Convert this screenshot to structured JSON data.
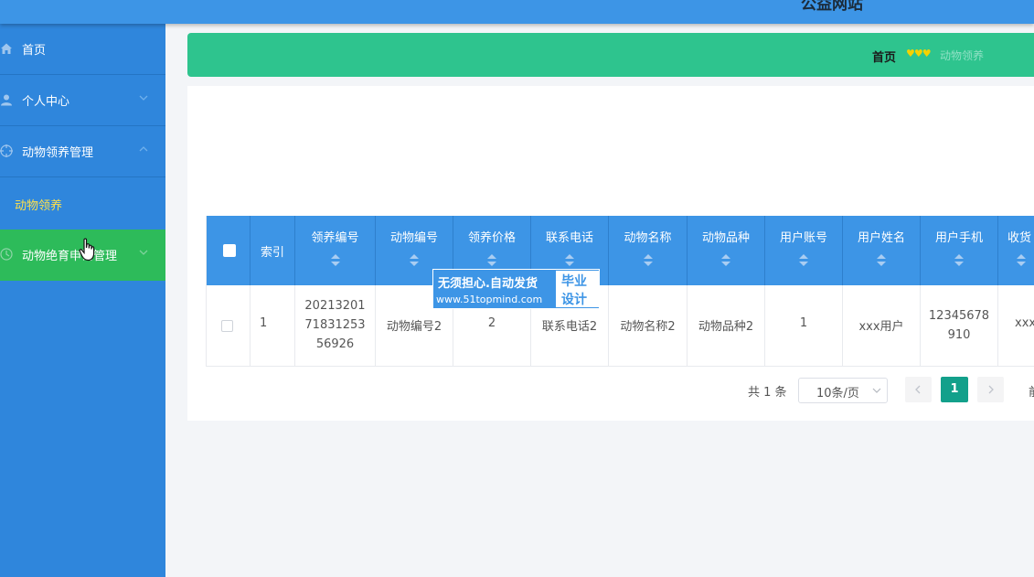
{
  "header": {
    "site_title": "公益网站"
  },
  "sidebar": {
    "items": [
      {
        "label": "首页",
        "icon": "home-icon"
      },
      {
        "label": "个人中心",
        "icon": "user-icon"
      },
      {
        "label": "动物领养管理",
        "icon": "target-icon"
      },
      {
        "label": "动物领养"
      },
      {
        "label": "动物绝育申请管理",
        "icon": "clock-icon"
      }
    ]
  },
  "breadcrumb": {
    "home": "首页",
    "separator": "♥♥♥",
    "current": "动物领养"
  },
  "table": {
    "columns": [
      "索引",
      "领养编号",
      "动物编号",
      "领养价格",
      "联系电话",
      "动物名称",
      "动物品种",
      "用户账号",
      "用户姓名",
      "用户手机",
      "收货"
    ],
    "rows": [
      {
        "index": "1",
        "adopt_no": "20213201\n71831253\n56926",
        "animal_no": "动物编号2",
        "price": "2",
        "phone": "联系电话2",
        "animal_name": "动物名称2",
        "breed": "动物品种2",
        "account": "1",
        "user_name": "xxx用户",
        "user_phone": "12345678\n910",
        "delivery": "xxx"
      }
    ]
  },
  "watermark": {
    "line1": "无须担心.自动发货",
    "line2": "www.51topmind.com",
    "box1": "毕业",
    "box2": "设计"
  },
  "pagination": {
    "total": "共 1 条",
    "page_size": "10条/页",
    "current": "1",
    "extra": "前"
  },
  "colors": {
    "primary": "#3d95e6",
    "sidebar": "#2f86dc",
    "breadcrumb": "#2ec48e",
    "active_green": "#2dbb5a",
    "page_active": "#13a08b"
  }
}
